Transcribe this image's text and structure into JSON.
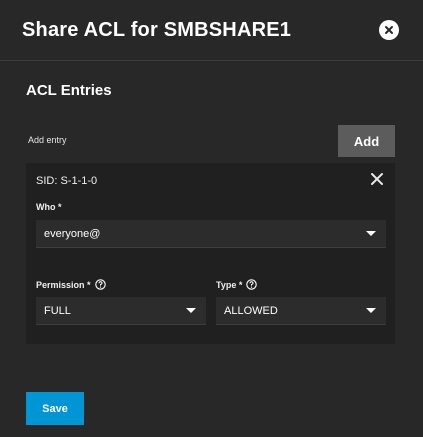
{
  "dialog": {
    "title": "Share ACL for SMBSHARE1"
  },
  "section": {
    "title": "ACL Entries",
    "add_entry_label": "Add entry",
    "add_button": "Add"
  },
  "entry": {
    "sid": "SID: S-1-1-0",
    "who_label": "Who *",
    "who_value": "everyone@",
    "permission_label": "Permission *",
    "permission_value": "FULL",
    "type_label": "Type *",
    "type_value": "ALLOWED"
  },
  "footer": {
    "save_button": "Save"
  },
  "colors": {
    "background": "#282828",
    "card": "#202020",
    "field": "#2c2c2c",
    "add_button": "#5c5c5c",
    "save_button": "#0095d5"
  }
}
